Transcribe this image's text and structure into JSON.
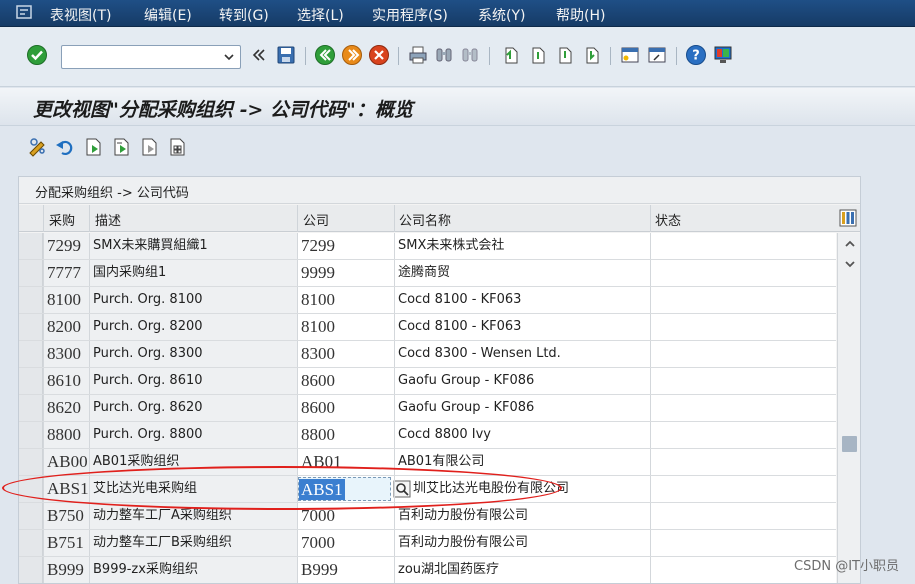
{
  "menu": {
    "items": [
      {
        "label": "表视图(T)"
      },
      {
        "label": "编辑(E)"
      },
      {
        "label": "转到(G)"
      },
      {
        "label": "选择(L)"
      },
      {
        "label": "实用程序(S)"
      },
      {
        "label": "系统(Y)"
      },
      {
        "label": "帮助(H)"
      }
    ]
  },
  "toolbar": {
    "command_value": "",
    "colors": {
      "ok": "#2f9e3a",
      "back": "#2f9e3a",
      "exit": "#e88a1a",
      "cancel": "#d9431e",
      "help": "#2a6fc2",
      "save": "#3a6fb0"
    }
  },
  "title": "更改视图\"分配采购组织 -> 公司代码\"：概览",
  "table": {
    "caption": "分配采购组织 -> 公司代码",
    "headers": {
      "purch_org": "采购",
      "description": "描述",
      "company": "公司",
      "company_name": "公司名称",
      "status": "状态"
    },
    "rows": [
      {
        "purch_org": "7299",
        "description": "SMX未来購買組織1",
        "company": "7299",
        "company_name": "SMX未来株式会社",
        "status": ""
      },
      {
        "purch_org": "7777",
        "description": "国内采购组1",
        "company": "9999",
        "company_name": "途腾商贸",
        "status": ""
      },
      {
        "purch_org": "8100",
        "description": "Purch. Org. 8100",
        "company": "8100",
        "company_name": "Cocd 8100 - KF063",
        "status": ""
      },
      {
        "purch_org": "8200",
        "description": "Purch. Org. 8200",
        "company": "8100",
        "company_name": "Cocd 8100 - KF063",
        "status": ""
      },
      {
        "purch_org": "8300",
        "description": "Purch. Org. 8300",
        "company": "8300",
        "company_name": "Cocd 8300 - Wensen Ltd.",
        "status": ""
      },
      {
        "purch_org": "8610",
        "description": "Purch. Org. 8610",
        "company": "8600",
        "company_name": "Gaofu Group - KF086",
        "status": ""
      },
      {
        "purch_org": "8620",
        "description": "Purch. Org. 8620",
        "company": "8600",
        "company_name": "Gaofu Group - KF086",
        "status": ""
      },
      {
        "purch_org": "8800",
        "description": "Purch. Org. 8800",
        "company": "8800",
        "company_name": "Cocd 8800 Ivy",
        "status": ""
      },
      {
        "purch_org": "AB00",
        "description": "AB01采购组织",
        "company": "AB01",
        "company_name": "AB01有限公司",
        "status": ""
      },
      {
        "purch_org": "ABS1",
        "description": "艾比达光电采购组",
        "company": "ABS1",
        "company_name": "圳艾比达光电股份有限公司",
        "status": ""
      },
      {
        "purch_org": "B750",
        "description": "动力整车工厂A采购组织",
        "company": "7000",
        "company_name": "百利动力股份有限公司",
        "status": ""
      },
      {
        "purch_org": "B751",
        "description": "动力整车工厂B采购组织",
        "company": "7000",
        "company_name": "百利动力股份有限公司",
        "status": ""
      },
      {
        "purch_org": "B999",
        "description": "B999-zx采购组织",
        "company": "B999",
        "company_name": "zou湖北国药医疗",
        "status": ""
      }
    ],
    "editing_row_index": 9
  },
  "watermark": "CSDN @IT小职员"
}
